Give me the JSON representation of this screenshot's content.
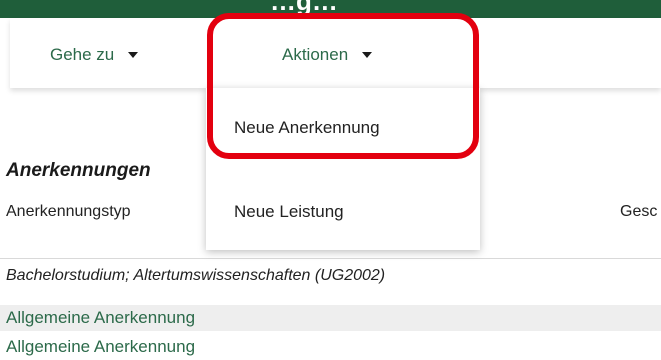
{
  "header": {
    "title": "…g…"
  },
  "toolbar": {
    "goto_label": "Gehe zu",
    "actions_label": "Aktionen"
  },
  "actions_menu": {
    "items": [
      {
        "label": "Neue Anerkennung"
      },
      {
        "label": "Neue Leistung"
      }
    ]
  },
  "section": {
    "title": "Anerkennungen",
    "columns": [
      "Anerkennungstyp",
      "Gesc"
    ]
  },
  "table": {
    "group_label": "Bachelorstudium; Altertumswissenschaften (UG2002)",
    "rows": [
      {
        "label": "Allgemeine Anerkennung"
      },
      {
        "label": "Allgemeine Anerkennung"
      }
    ]
  },
  "colors": {
    "header_bg": "#1f5e3a",
    "link": "#2c6a4a",
    "highlight": "#e3000f"
  }
}
